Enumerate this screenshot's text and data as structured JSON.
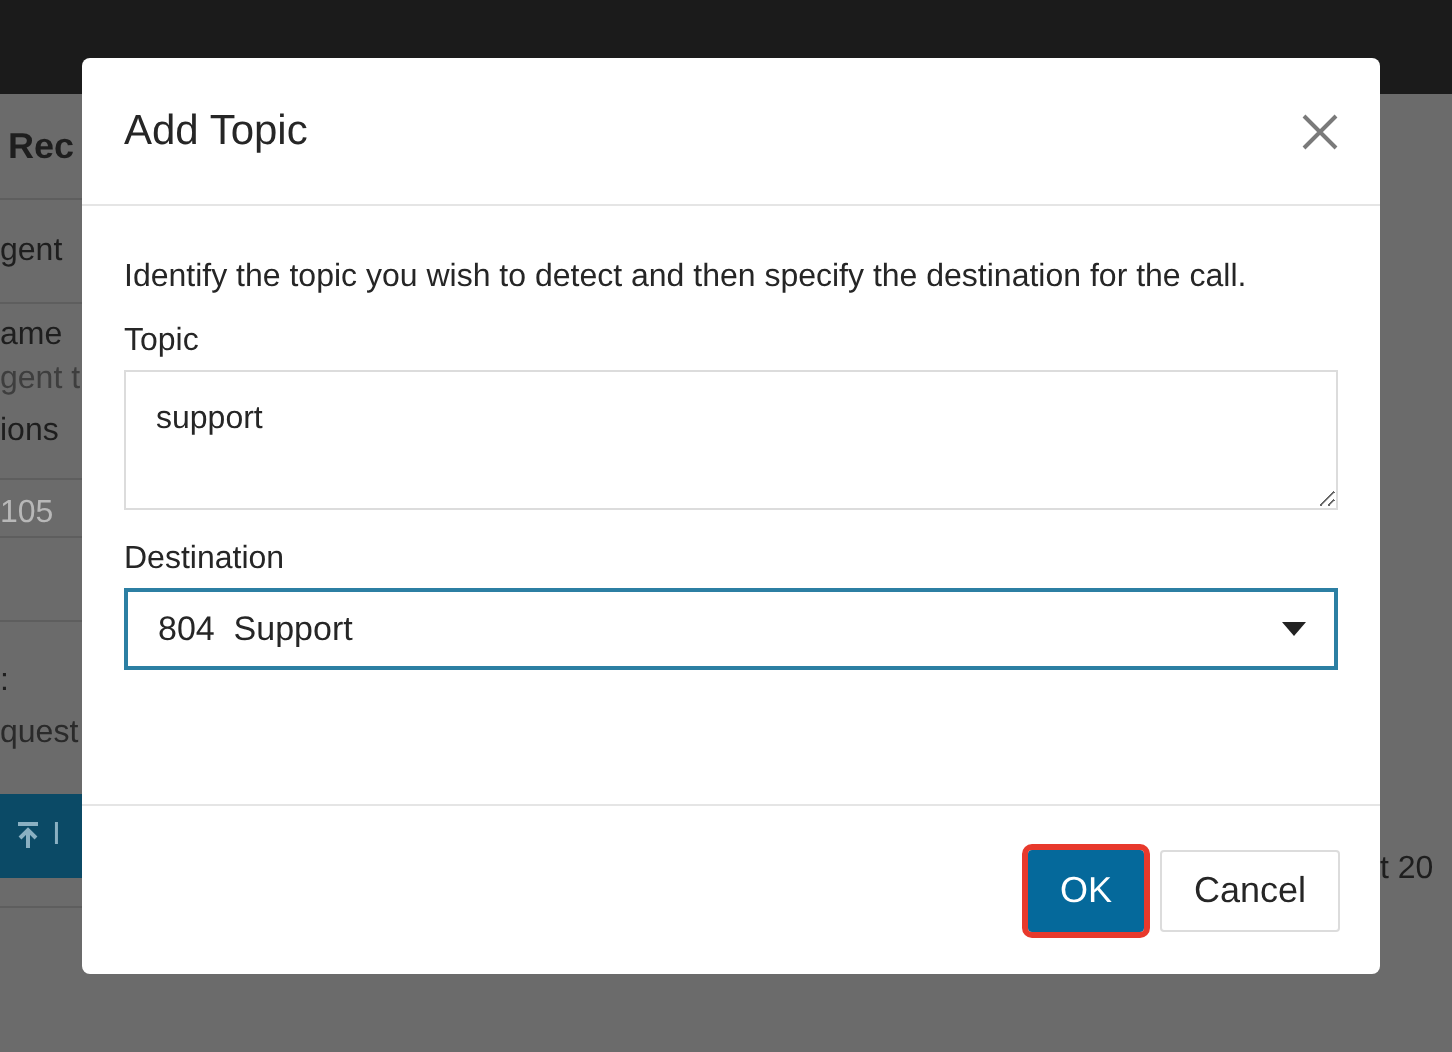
{
  "background": {
    "title": "Rec",
    "rows": [
      {
        "label": "gent"
      }
    ],
    "fields": [
      {
        "label": "ame",
        "value": "gent t"
      },
      {
        "label": "ions",
        "value": "105"
      }
    ],
    "section": {
      "label": ":",
      "value": "quest",
      "right_value": "t 20"
    },
    "button": {
      "label": "I"
    }
  },
  "dialog": {
    "title": "Add Topic",
    "description": "Identify the topic you wish to detect and then specify the destination for the call.",
    "topic": {
      "label": "Topic",
      "value": "support"
    },
    "destination": {
      "label": "Destination",
      "value": "804  Support",
      "focused": true
    },
    "buttons": [
      {
        "label": "OK",
        "primary": true,
        "highlighted": true
      },
      {
        "label": "Cancel",
        "primary": false,
        "highlighted": false
      }
    ]
  }
}
